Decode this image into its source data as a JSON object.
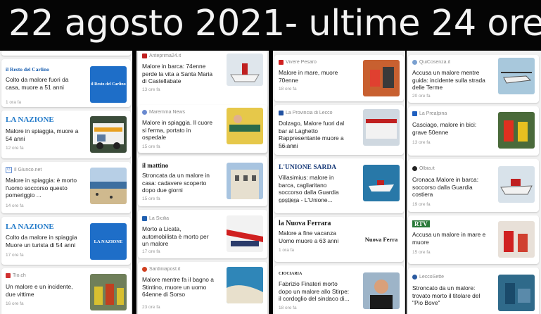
{
  "header": {
    "title": "22 agosto 2021- ultime 24 ore"
  },
  "columns": [
    {
      "cards": [
        {
          "source": "il Resto del Carlino",
          "title": "Colto da malore fuori da casa, muore a 51 anni",
          "time": "1 ora fa",
          "thumb_logo": "il Resto del Carlino"
        },
        {
          "source": "LA NAZIONE",
          "title": "Malore in spiaggia, muore a 54 anni",
          "time": "12 ore fa"
        },
        {
          "source": "Il Giunco.net",
          "title": "Malore in spiaggia: è morto l'uomo soccorso questo pomeriggio ...",
          "time": "14 ore fa"
        },
        {
          "source": "LA NAZIONE",
          "title": "Colto da malore in spiaggia Muore un turista di 54 anni",
          "time": "17 ore fa",
          "thumb_logo": "LA NAZIONE"
        },
        {
          "source": "Tio.ch",
          "title": "Un malore e un incidente, due vittime",
          "time": "16 ore fa"
        }
      ]
    },
    {
      "cards": [
        {
          "source": "Anteprima24.it",
          "title": "Malore in barca: 74enne perde la vita a Santa Maria di Castellabate",
          "time": "13 ore fa"
        },
        {
          "source": "Maremma News",
          "title": "Malore in spiaggia. Il cuore si ferma, portato in ospedale",
          "time": "15 ore fa"
        },
        {
          "source": "il mattino",
          "title": "Stroncata da un malore in casa: cadavere scoperto dopo due giorni",
          "time": "15 ore fa"
        },
        {
          "source": "La Sicilia",
          "title": "Morto a Licata, automobilista è morto per un malore",
          "time": "17 ore fa"
        },
        {
          "source": "Sardiniapost.it",
          "title": "Malore mentre fa il bagno a Stintino, muore un uomo 64enne di Sorso",
          "time": "23 ore fa"
        }
      ]
    },
    {
      "cards": [
        {
          "source": "Vivere Pesaro",
          "title": "Malore in mare, muore 70enne",
          "time": "18 ore fa"
        },
        {
          "source": "La Provincia di Lecco",
          "title": "Dolzago, Malore fuori dal bar al Laghetto Rappresentante muore a 56 anni",
          "time": "13 ore fa"
        },
        {
          "source": "L'UNIONE SARDA",
          "title": "Villasimius: malore in barca, cagliaritano soccorso dalla Guardia costiera - L'Unione...",
          "time": "10 ore fa"
        },
        {
          "source": "la Nuova Ferrara",
          "title": "Malore a fine vacanza Uomo muore a 63 anni",
          "time": "1 ora fa",
          "thumb_logo": "Nuova Ferra"
        },
        {
          "source": "CIOCIARIA",
          "title": "Fabrizio Finateri morto dopo un malore allo Stirpe: il cordoglio del sindaco di...",
          "time": "18 ore fa"
        }
      ]
    },
    {
      "cards": [
        {
          "source": "QuiCosenza.it",
          "title": "Accusa un malore mentre guida: incidente sulla strada delle Terme",
          "time": "20 ore fa"
        },
        {
          "source": "La Prealpina",
          "title": "Casciago, malore in bici: grave 50enne",
          "time": "13 ore fa"
        },
        {
          "source": "Olbia.it",
          "title": "Cronaca Malore in barca: soccorso dalla Guardia costiera",
          "time": "19 ore fa"
        },
        {
          "source": "RTV",
          "title": "Accusa un malore in mare e muore",
          "time": "15 ore fa"
        },
        {
          "source": "LeccoSette",
          "title": "Stroncato da un malore: trovato morto il titolare del \"Pio Bove\"",
          "time": ""
        }
      ]
    }
  ],
  "colors": {
    "accent": "#1a3c7a",
    "nazione": "#1f78c8"
  }
}
